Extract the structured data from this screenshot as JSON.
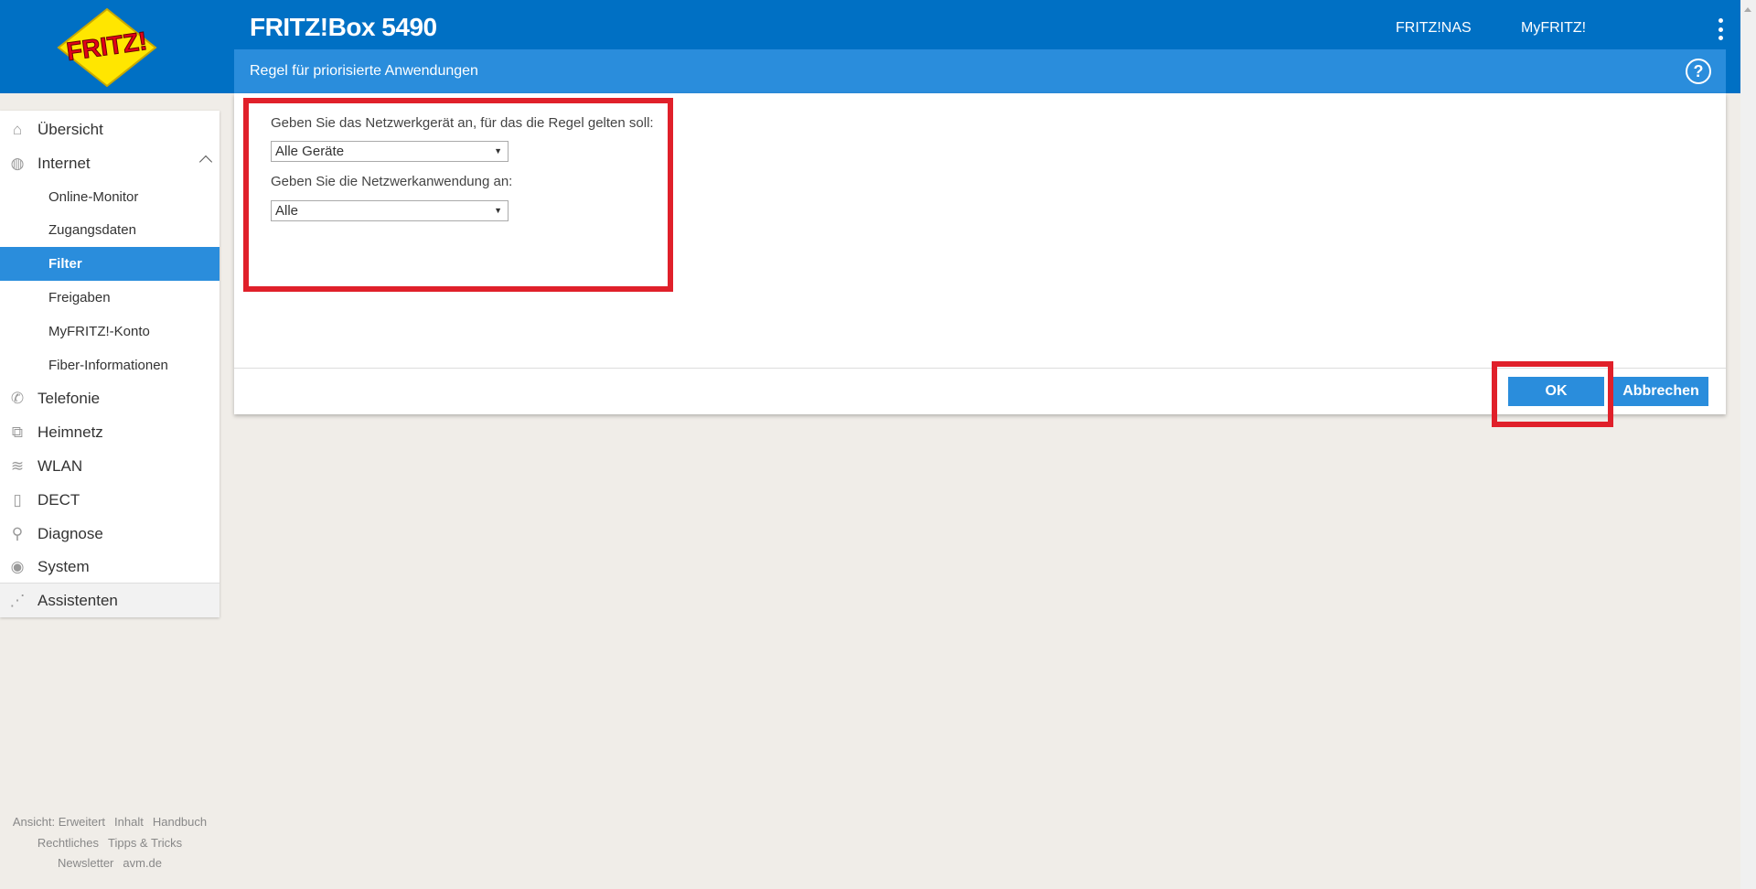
{
  "header": {
    "logo_text": "FRITZ!",
    "title": "FRITZ!Box 5490",
    "links": [
      "FRITZ!NAS",
      "MyFRITZ!"
    ]
  },
  "page": {
    "title": "Regel für priorisierte Anwendungen",
    "help": "?"
  },
  "sidebar": {
    "items": [
      {
        "label": "Übersicht",
        "icon": "home-icon"
      },
      {
        "label": "Internet",
        "icon": "globe-icon"
      },
      {
        "label": "Online-Monitor"
      },
      {
        "label": "Zugangsdaten"
      },
      {
        "label": "Filter",
        "active": true
      },
      {
        "label": "Freigaben"
      },
      {
        "label": "MyFRITZ!-Konto"
      },
      {
        "label": "Fiber-Informationen"
      },
      {
        "label": "Telefonie",
        "icon": "phone-icon"
      },
      {
        "label": "Heimnetz",
        "icon": "network-icon"
      },
      {
        "label": "WLAN",
        "icon": "wifi-icon"
      },
      {
        "label": "DECT",
        "icon": "dect-phone-icon"
      },
      {
        "label": "Diagnose",
        "icon": "diagnose-icon"
      },
      {
        "label": "System",
        "icon": "system-icon"
      },
      {
        "label": "Assistenten",
        "icon": "wizard-icon"
      }
    ]
  },
  "footer": {
    "links": [
      "Ansicht: Erweitert",
      "Inhalt",
      "Handbuch",
      "Rechtliches",
      "Tipps & Tricks",
      "Newsletter",
      "avm.de"
    ]
  },
  "form": {
    "device_label": "Geben Sie das Netzwerkgerät an, für das die Regel gelten soll:",
    "device_value": "Alle Geräte",
    "app_label": "Geben Sie die Netzwerkanwendung an:",
    "app_value": "Alle"
  },
  "buttons": {
    "ok": "OK",
    "cancel": "Abbrechen"
  },
  "colors": {
    "header": "#0070c4",
    "subbar": "#2a8ddc",
    "highlight": "#e0202a"
  }
}
